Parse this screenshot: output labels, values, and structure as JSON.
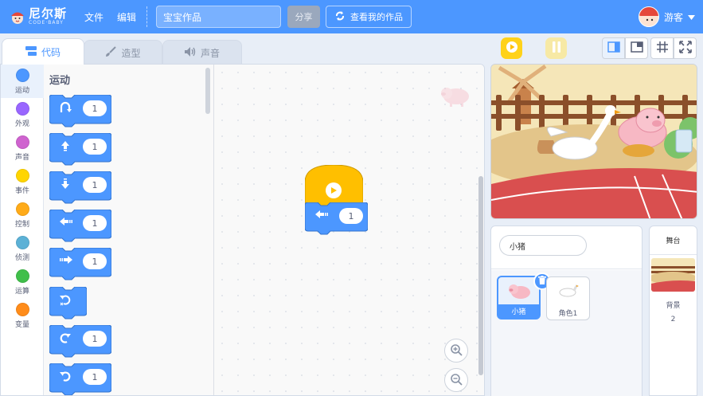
{
  "app": {
    "logo_text": "尼尔斯",
    "logo_sub": "CODE·BABY",
    "menu_file": "文件",
    "menu_edit": "编辑",
    "project_title": "宝宝作品",
    "share_label": "分享",
    "my_works_label": "查看我的作品",
    "username": "游客",
    "accent_color": "#4c97ff"
  },
  "tabs": {
    "code": "代码",
    "costume": "造型",
    "sound": "声音"
  },
  "categories": [
    {
      "label": "运动",
      "color": "#4c97ff"
    },
    {
      "label": "外观",
      "color": "#9966ff"
    },
    {
      "label": "声音",
      "color": "#cf63cf"
    },
    {
      "label": "事件",
      "color": "#ffd500"
    },
    {
      "label": "控制",
      "color": "#ffab19"
    },
    {
      "label": "侦测",
      "color": "#5cb1d6"
    },
    {
      "label": "运算",
      "color": "#40bf4a"
    },
    {
      "label": "变量",
      "color": "#ff8c1a"
    }
  ],
  "palette": {
    "title": "运动",
    "blocks": [
      {
        "icon": "hop-icon",
        "value": "1"
      },
      {
        "icon": "move-up-icon",
        "value": "1"
      },
      {
        "icon": "move-down-icon",
        "value": "1"
      },
      {
        "icon": "move-left-icon",
        "value": "1"
      },
      {
        "icon": "move-right-icon",
        "value": "1"
      },
      {
        "icon": "reset-icon",
        "value": ""
      },
      {
        "icon": "turn-right-icon",
        "value": "1"
      },
      {
        "icon": "turn-left-icon",
        "value": "1"
      }
    ]
  },
  "workspace": {
    "script_move_left_value": "1"
  },
  "sprites": {
    "selected_name": "小猪",
    "items": [
      {
        "name": "小猪",
        "selected": true
      },
      {
        "name": "角色1",
        "selected": false
      }
    ]
  },
  "stage_panel": {
    "title": "舞台",
    "backdrop_label": "背景",
    "backdrop_count": "2"
  }
}
